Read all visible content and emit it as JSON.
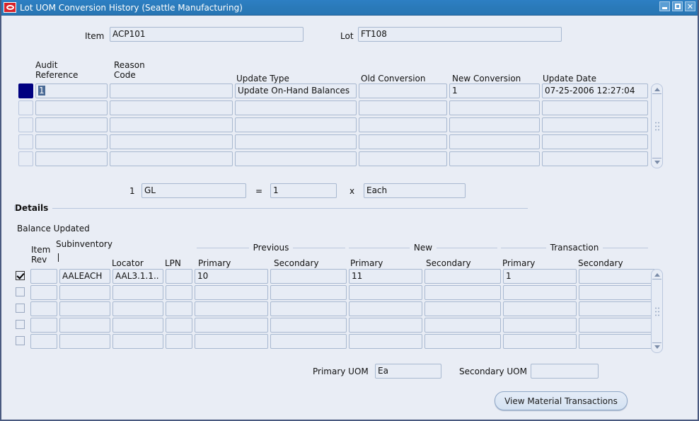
{
  "window": {
    "title": "Lot UOM Conversion History  (Seattle Manufacturing)",
    "logo_icon": "oracle-logo-icon",
    "minimize_icon": "minimize-icon",
    "maximize_icon": "maximize-icon",
    "close_icon": "close-icon",
    "accent_title_bar": "#2a7ab9",
    "background": "#e9edf5"
  },
  "header": {
    "item_label": "Item",
    "item_value": "ACP101",
    "lot_label": "Lot",
    "lot_value": "FT108"
  },
  "history": {
    "columns": [
      "Audit\nReference",
      "Reason\nCode",
      "Update Type",
      "Old Conversion",
      "New Conversion",
      "Update Date"
    ],
    "rows": [
      {
        "current": true,
        "audit_reference": "1",
        "reason_code": "",
        "update_type": "Update On-Hand Balances",
        "old_conversion": "",
        "new_conversion": "1",
        "update_date": "07-25-2006 12:27:04"
      },
      {
        "current": false,
        "audit_reference": "",
        "reason_code": "",
        "update_type": "",
        "old_conversion": "",
        "new_conversion": "",
        "update_date": ""
      },
      {
        "current": false,
        "audit_reference": "",
        "reason_code": "",
        "update_type": "",
        "old_conversion": "",
        "new_conversion": "",
        "update_date": ""
      },
      {
        "current": false,
        "audit_reference": "",
        "reason_code": "",
        "update_type": "",
        "old_conversion": "",
        "new_conversion": "",
        "update_date": ""
      },
      {
        "current": false,
        "audit_reference": "",
        "reason_code": "",
        "update_type": "",
        "old_conversion": "",
        "new_conversion": "",
        "update_date": ""
      }
    ],
    "scrollbar": {
      "up_icon": "scroll-up-arrow-icon",
      "down_icon": "scroll-down-arrow-icon",
      "grip_icon": "scroll-thumb-grip-icon"
    }
  },
  "conversion": {
    "leading_number": "1",
    "uom": "GL",
    "equals": "=",
    "quantity": "1",
    "times": "x",
    "base_uom": "Each"
  },
  "details": {
    "section_title": "Details",
    "balance_updated_label": "Balance Updated",
    "group_previous": "Previous",
    "group_new": "New",
    "group_transaction": "Transaction",
    "columns": {
      "item_rev": "Item\nRev",
      "subinventory": "Subinventory",
      "locator": "Locator",
      "lpn": "LPN",
      "previous_primary": "Primary",
      "previous_secondary": "Secondary",
      "new_primary": "Primary",
      "new_secondary": "Secondary",
      "transaction_primary": "Primary",
      "transaction_secondary": "Secondary"
    },
    "rows": [
      {
        "checked": true,
        "item_rev": "",
        "subinventory": "AALEACH",
        "locator": "AAL3.1.1..",
        "lpn": "",
        "previous_primary": "10",
        "previous_secondary": "",
        "new_primary": "11",
        "new_secondary": "",
        "transaction_primary": "1",
        "transaction_secondary": ""
      },
      {
        "checked": false,
        "item_rev": "",
        "subinventory": "",
        "locator": "",
        "lpn": "",
        "previous_primary": "",
        "previous_secondary": "",
        "new_primary": "",
        "new_secondary": "",
        "transaction_primary": "",
        "transaction_secondary": ""
      },
      {
        "checked": false,
        "item_rev": "",
        "subinventory": "",
        "locator": "",
        "lpn": "",
        "previous_primary": "",
        "previous_secondary": "",
        "new_primary": "",
        "new_secondary": "",
        "transaction_primary": "",
        "transaction_secondary": ""
      },
      {
        "checked": false,
        "item_rev": "",
        "subinventory": "",
        "locator": "",
        "lpn": "",
        "previous_primary": "",
        "previous_secondary": "",
        "new_primary": "",
        "new_secondary": "",
        "transaction_primary": "",
        "transaction_secondary": ""
      },
      {
        "checked": false,
        "item_rev": "",
        "subinventory": "",
        "locator": "",
        "lpn": "",
        "previous_primary": "",
        "previous_secondary": "",
        "new_primary": "",
        "new_secondary": "",
        "transaction_primary": "",
        "transaction_secondary": ""
      }
    ],
    "scrollbar": {
      "up_icon": "scroll-up-arrow-icon",
      "down_icon": "scroll-down-arrow-icon",
      "grip_icon": "scroll-thumb-grip-icon"
    }
  },
  "footer": {
    "primary_uom_label": "Primary UOM",
    "primary_uom_value": "Ea",
    "secondary_uom_label": "Secondary UOM",
    "secondary_uom_value": "",
    "view_material_transactions_label": "View Material Transactions"
  }
}
